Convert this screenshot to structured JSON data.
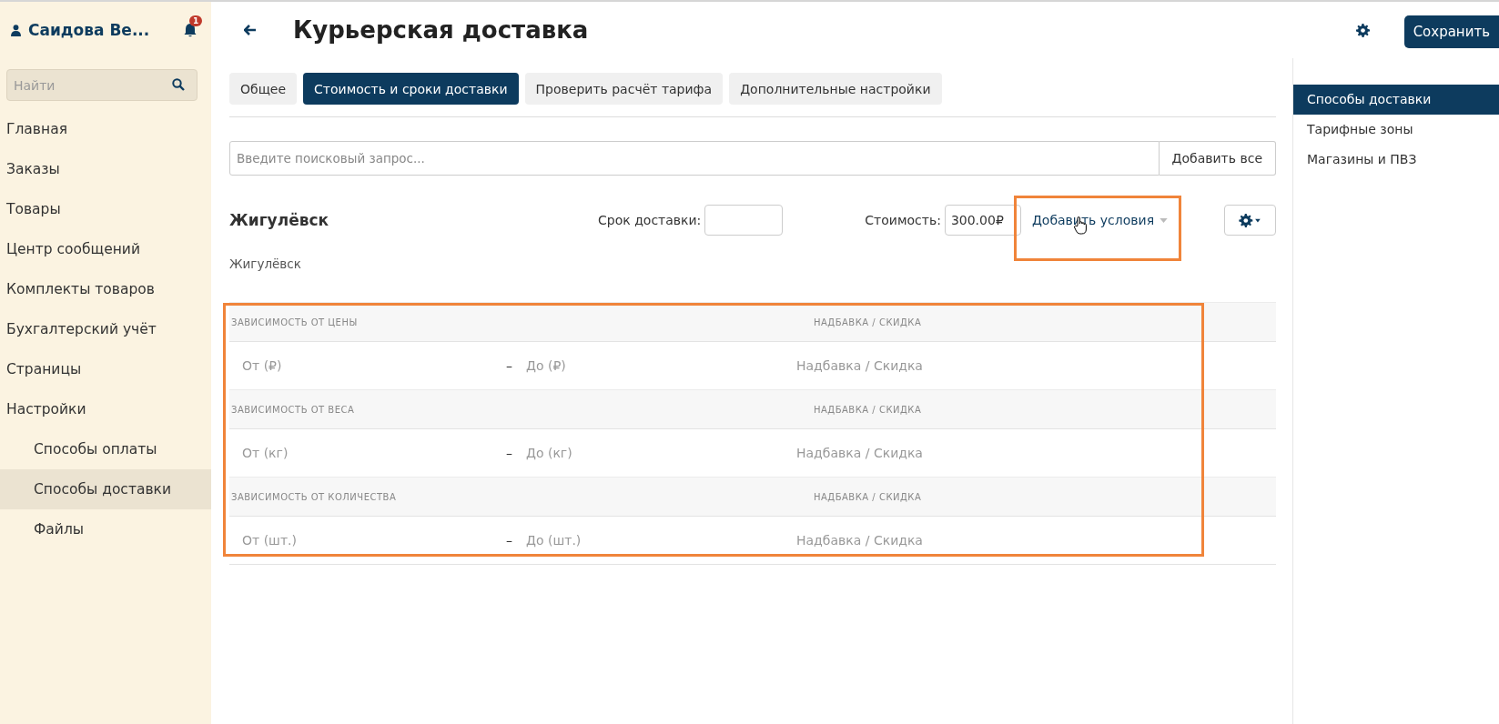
{
  "sidebar": {
    "user": "Саидова Ве...",
    "notifications": "1",
    "search": {
      "placeholder": "Найти"
    },
    "items": [
      {
        "label": "Главная",
        "selected": false
      },
      {
        "label": "Заказы",
        "selected": false
      },
      {
        "label": "Товары",
        "selected": false
      },
      {
        "label": "Центр сообщений",
        "selected": false
      },
      {
        "label": "Комплекты товаров",
        "selected": false
      },
      {
        "label": "Бухгалтерский учёт",
        "selected": false
      },
      {
        "label": "Страницы",
        "selected": false
      },
      {
        "label": "Настройки",
        "selected": false,
        "children": [
          {
            "label": "Способы оплаты",
            "selected": false
          },
          {
            "label": "Способы доставки",
            "selected": true
          },
          {
            "label": "Файлы",
            "selected": false
          }
        ]
      }
    ]
  },
  "header": {
    "title": "Курьерская доставка",
    "save_button": "Сохранить"
  },
  "tabs": [
    {
      "label": "Общее",
      "selected": false
    },
    {
      "label": "Стоимость и сроки доставки",
      "selected": true
    },
    {
      "label": "Проверить расчёт тарифа",
      "selected": false
    },
    {
      "label": "Дополнительные настройки",
      "selected": false
    }
  ],
  "search": {
    "placeholder": "Введите поисковый запрос...",
    "button": "Добавить все"
  },
  "zone": {
    "name": "Жигулёвск",
    "delivery_time_label": "Срок доставки:",
    "cost_label": "Стоимость:",
    "cost": "300.00₽",
    "add_conditions": "Добавить условия",
    "subtitle": "Жигулёвск"
  },
  "conditions": [
    {
      "heading": "ЗАВИСИМОСТЬ ОТ ЦЕНЫ",
      "column_heading": "НАДБАВКА / СКИДКА",
      "from_placeholder": "От (₽)",
      "separator": "–",
      "to_placeholder": "До (₽)",
      "markup_placeholder": "Надбавка / Скидка"
    },
    {
      "heading": "ЗАВИСИМОСТЬ ОТ ВЕСА",
      "column_heading": "НАДБАВКА / СКИДКА",
      "from_placeholder": "От (кг)",
      "separator": "–",
      "to_placeholder": "До (кг)",
      "markup_placeholder": "Надбавка / Скидка"
    },
    {
      "heading": "ЗАВИСИМОСТЬ ОТ КОЛИЧЕСТВА",
      "column_heading": "НАДБАВКА / СКИДКА",
      "from_placeholder": "От (шт.)",
      "separator": "–",
      "to_placeholder": "До (шт.)",
      "markup_placeholder": "Надбавка / Скидка"
    }
  ],
  "right_nav": [
    {
      "label": "Способы доставки",
      "selected": true
    },
    {
      "label": "Тарифные зоны",
      "selected": false
    },
    {
      "label": "Магазины и ПВЗ",
      "selected": false
    }
  ]
}
